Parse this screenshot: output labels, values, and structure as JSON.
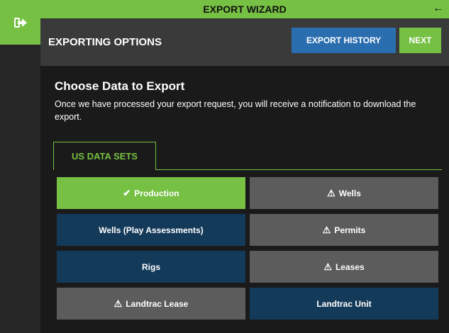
{
  "wizard": {
    "title": "EXPORT WIZARD",
    "back_icon": "←"
  },
  "rail": {
    "button_icon": "sign-out-icon"
  },
  "options_bar": {
    "title": "EXPORTING OPTIONS",
    "history_label": "EXPORT HISTORY",
    "next_label": "NEXT"
  },
  "content": {
    "heading": "Choose Data to Export",
    "description": "Once we have processed your export request, you will receive a notification to download the export.",
    "tab_label": "US DATA SETS"
  },
  "datasets": [
    {
      "label": "Production",
      "icon": "✔",
      "state": "selected"
    },
    {
      "label": "Wells",
      "icon": "⚠",
      "state": "warning"
    },
    {
      "label": "Wells (Play Assessments)",
      "icon": "",
      "state": "available"
    },
    {
      "label": "Permits",
      "icon": "⚠",
      "state": "warning"
    },
    {
      "label": "Rigs",
      "icon": "",
      "state": "available"
    },
    {
      "label": "Leases",
      "icon": "⚠",
      "state": "warning"
    },
    {
      "label": "Landtrac Lease",
      "icon": "⚠",
      "state": "warning"
    },
    {
      "label": "Landtrac Unit",
      "icon": "",
      "state": "available"
    }
  ],
  "colors": {
    "accent": "#76c043",
    "history_button": "#2b6eb0",
    "available_tile": "#143a5a",
    "warning_tile": "#5c5c5c"
  }
}
